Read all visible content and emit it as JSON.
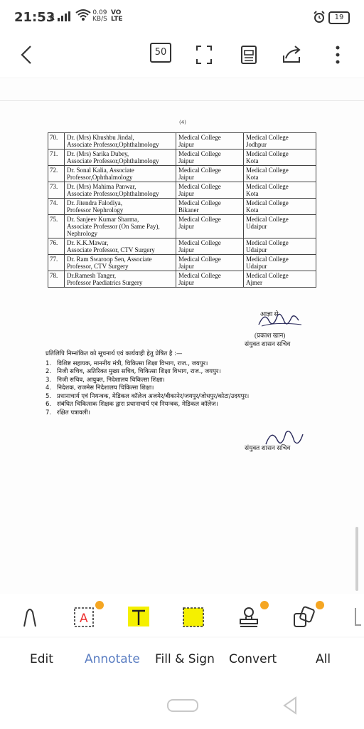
{
  "status_bar": {
    "time": "21:53",
    "signal": "R",
    "speed_value": "0.09",
    "speed_unit": "KB/S",
    "volte_top": "VO",
    "volte_bottom": "LTE",
    "battery": "19"
  },
  "toolbar": {
    "page_count": "50"
  },
  "document": {
    "page_number": "(4)",
    "rows": [
      {
        "no": "70.",
        "name": "Dr. (Mrs) Khushbu Jindal,",
        "name2": "Associate Professor,Ophthalmology",
        "from": "Medical College",
        "from2": "Jaipur",
        "to": "Medical College",
        "to2": "Jodhpur"
      },
      {
        "no": "71.",
        "name": "Dr. (Mrs) Sarika Dubey,",
        "name2": "Associate Professor,Ophthalmology",
        "from": "Medical College",
        "from2": "Jaipur",
        "to": "Medical College",
        "to2": "Kota"
      },
      {
        "no": "72.",
        "name": "Dr. Sonal Kalia, Associate",
        "name2": "Professor,Ophthalmology",
        "from": "Medical College",
        "from2": "Jaipur",
        "to": "Medical College",
        "to2": "Kota"
      },
      {
        "no": "73.",
        "name": "Dr. (Mrs) Mahima Panwar,",
        "name2": "Associate Professor,Ophthalmology",
        "from": "Medical College",
        "from2": "Jaipur",
        "to": "Medical College",
        "to2": "Kota"
      },
      {
        "no": "74.",
        "name": "Dr. Jitendra Falodiya,",
        "name2": "Professor Nephrology",
        "from": "Medical College",
        "from2": "Bikaner",
        "to": "Medical College",
        "to2": "Kota"
      },
      {
        "no": "75.",
        "name": "Dr. Sanjeev Kumar Sharma,",
        "name2": "Associate Professor (On Same Pay), Nephrology",
        "from": "Medical College",
        "from2": "Jaipur",
        "to": "Medical College",
        "to2": "Udaipur"
      },
      {
        "no": "76.",
        "name": "Dr. K.K.Mawar,",
        "name2": "Associate Professor, CTV Surgery",
        "from": "Medical College",
        "from2": "Jaipur",
        "to": "Medical College",
        "to2": "Udaipur"
      },
      {
        "no": "77.",
        "name": "Dr. Ram Swaroop Sen, Associate",
        "name2": "Professor, CTV Surgery",
        "from": "Medical College",
        "from2": "Jaipur",
        "to": "Medical College",
        "to2": "Udaipur"
      },
      {
        "no": "78.",
        "name": "Dr.Ramesh Tanger,",
        "name2": "Professor Paediatrics Surgery",
        "from": "Medical College",
        "from2": "Jaipur",
        "to": "Medical College",
        "to2": "Ajmer"
      }
    ],
    "order_text": "आज्ञा से",
    "signatory_name": "(प्रकाश खान)",
    "signatory_designation": "संयुक्त शासन सचिव",
    "copy_intro": "प्रतिलिपि निम्नांकित को सूचनार्थ एवं कार्यवाही हेतु प्रेषित है :—",
    "copy_items": [
      {
        "n": "1.",
        "text": "विशिष्ट सहायक, माननीय मंत्री, चिकित्सा शिक्षा विभाग, राज., जयपुर।"
      },
      {
        "n": "2.",
        "text": "निजी सचिव, अतिरिक्त मुख्य सचिव, चिकित्सा शिक्षा विभाग, राज., जयपुर।"
      },
      {
        "n": "3.",
        "text": "निजी सचिव, आयुक्त, निदेशालय चिकित्सा शिक्षा।"
      },
      {
        "n": "4.",
        "text": "निदेशक, राजमेस निदेशालय चिकित्सा शिक्षा।"
      },
      {
        "n": "5.",
        "text": "प्रधानाचार्य एवं नियन्त्रक, मेडिकल कॉलेज अजमेर/बीकानेर/जयपुर/जोधपुर/कोटा/उदयपुर।"
      },
      {
        "n": "6.",
        "text": "संबंधित चिकित्सक शिक्षक द्वारा प्रधानाचार्य एवं नियन्त्रक, मेडिकल कॉलेज।"
      },
      {
        "n": "7.",
        "text": "रक्षित पत्रावली।"
      }
    ],
    "footer_designation": "संयुक्त शासन सचिव"
  },
  "bottom_tools": [
    "pen-tool",
    "text-box-tool",
    "text-highlight-tool",
    "area-highlight-tool",
    "stamp-tool",
    "shapes-tool"
  ],
  "tabs": [
    {
      "label": "Edit",
      "active": false
    },
    {
      "label": "Annotate",
      "active": true
    },
    {
      "label": "Fill & Sign",
      "active": false
    },
    {
      "label": "Convert",
      "active": false
    },
    {
      "label": "All",
      "active": false
    }
  ],
  "colors": {
    "accent": "#5b7ec2",
    "highlight": "#f5f000",
    "crown": "#f5a623"
  }
}
